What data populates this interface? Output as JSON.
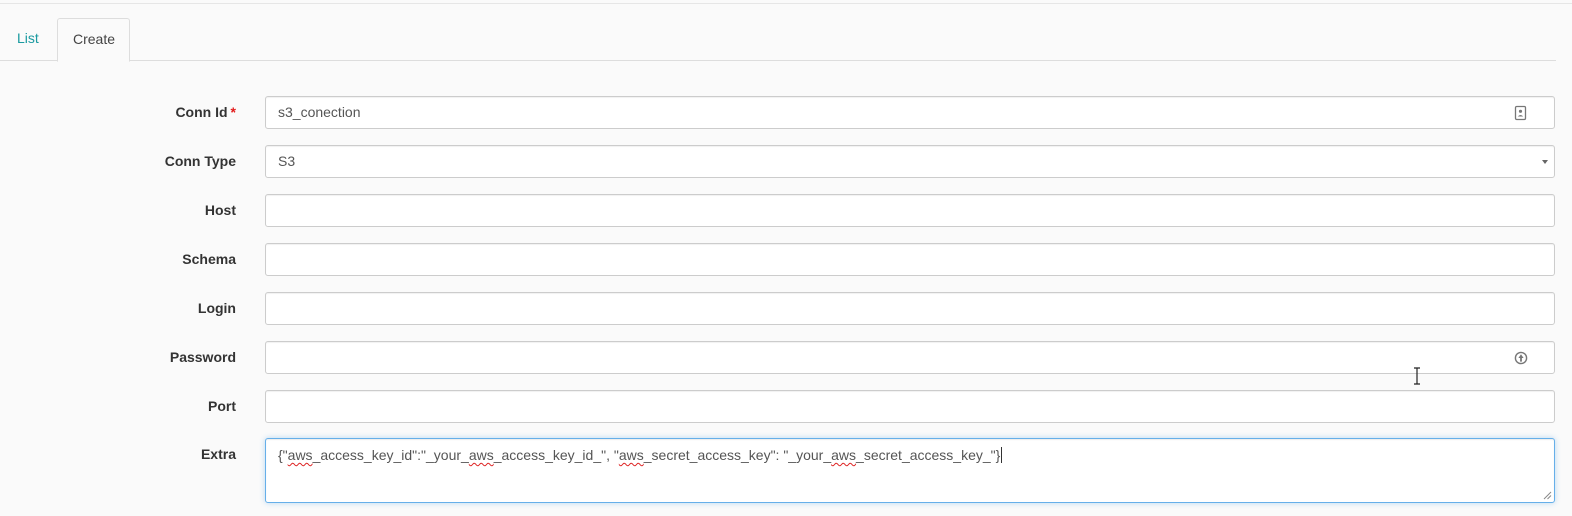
{
  "tabs": [
    {
      "label": "List",
      "active": false
    },
    {
      "label": "Create",
      "active": true
    }
  ],
  "form": {
    "fields": {
      "conn_id": {
        "label": "Conn Id",
        "required_mark": "*",
        "value": "s3_conection",
        "icon": "contact-card-icon"
      },
      "conn_type": {
        "label": "Conn Type",
        "value": "S3"
      },
      "host": {
        "label": "Host",
        "value": ""
      },
      "schema": {
        "label": "Schema",
        "value": ""
      },
      "login": {
        "label": "Login",
        "value": ""
      },
      "password": {
        "label": "Password",
        "value": "",
        "icon": "password-reveal-icon"
      },
      "port": {
        "label": "Port",
        "value": ""
      },
      "extra": {
        "label": "Extra",
        "value_parts": [
          "{\"",
          "aws",
          "_access_key_id\":\"_your_",
          "aws",
          "_access_key_id_\", \"",
          "aws",
          "_secret_access_key\": \"_your_",
          "aws",
          "_secret_access_key_\"}"
        ]
      }
    }
  },
  "colors": {
    "tab_link": "#1a9aa0",
    "required": "#e21b1b",
    "focus_border": "#66afe9",
    "spellcheck": "#dd2222"
  }
}
